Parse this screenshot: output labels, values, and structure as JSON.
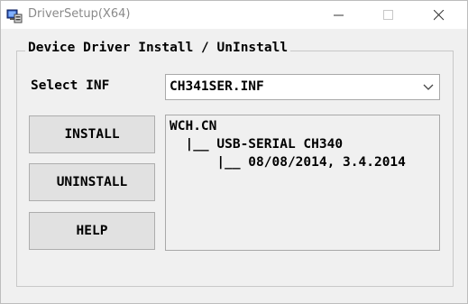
{
  "window": {
    "title": "DriverSetup(X64)",
    "icon": "computer-setup-icon"
  },
  "caption_buttons": {
    "minimize": "minimize-icon",
    "maximize": "maximize-icon",
    "close": "close-icon"
  },
  "group": {
    "title": "Device Driver Install / UnInstall"
  },
  "select_inf": {
    "label": "Select INF",
    "value": "CH341SER.INF"
  },
  "buttons": {
    "install": "INSTALL",
    "uninstall": "UNINSTALL",
    "help": "HELP"
  },
  "info": {
    "lines": [
      "WCH.CN",
      "  |__ USB-SERIAL CH340",
      "      |__ 08/08/2014, 3.4.2014"
    ]
  }
}
